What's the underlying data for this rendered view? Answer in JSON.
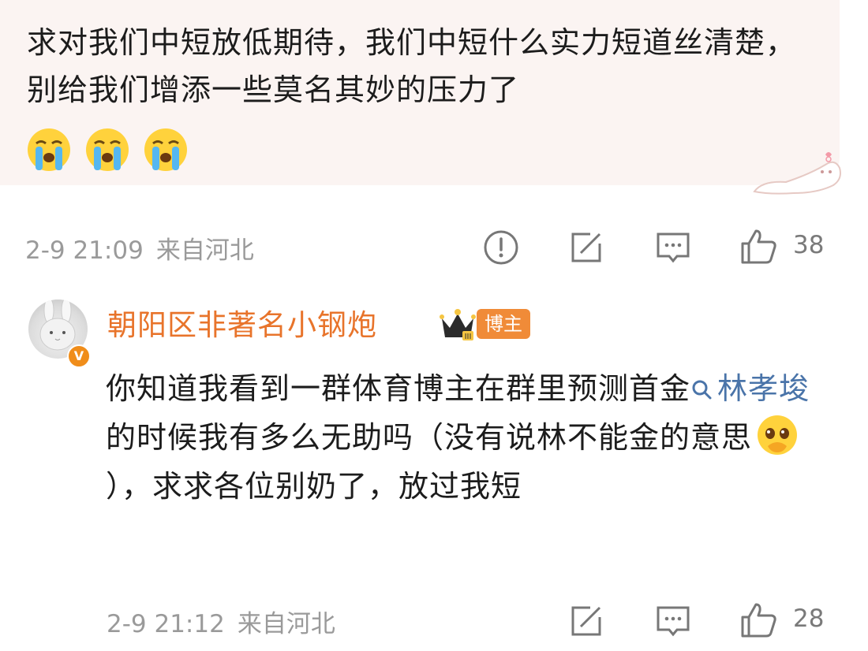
{
  "first_comment": {
    "text": "求对我们中短放低期待，我们中短什么实力短道丝清楚，别给我们增添一些莫名其妙的压力了",
    "emojis": [
      "crying-face",
      "crying-face",
      "crying-face"
    ],
    "date": "2-9 21:09",
    "location": "来自河北",
    "likes": "38"
  },
  "reply": {
    "username": "朝阳区非著名小钢炮",
    "badge": "博主",
    "text_a": "你知道我看到一群体育博主在群里预测首金",
    "hashtag": "林孝埈",
    "text_b": "的时候我有多么无助吗（没有说林不能金的意思",
    "text_c": "），求求各位别奶了，放过我短",
    "date": "2-9 21:12",
    "location": "来自河北",
    "likes": "28"
  },
  "colors": {
    "bubble_bg": "#fbf4f2",
    "username": "#e8742b",
    "hashtag": "#4a74a9",
    "meta": "#9a9a9a",
    "badge": "#f08b38"
  }
}
